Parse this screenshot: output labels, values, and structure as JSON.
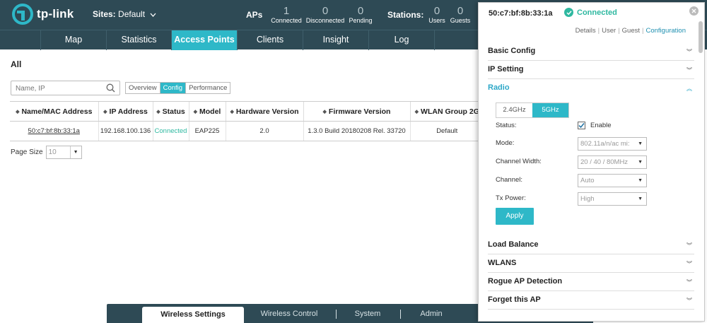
{
  "header": {
    "logo_text": "tp-link",
    "sites_label": "Sites:",
    "site_name": "Default",
    "aps_label": "APs",
    "aps": [
      {
        "value": "1",
        "label": "Connected"
      },
      {
        "value": "0",
        "label": "Disconnected"
      },
      {
        "value": "0",
        "label": "Pending"
      }
    ],
    "stations_label": "Stations:",
    "stations": [
      {
        "value": "0",
        "label": "Users"
      },
      {
        "value": "0",
        "label": "Guests"
      }
    ]
  },
  "nav": {
    "items": [
      "Map",
      "Statistics",
      "Access Points",
      "Clients",
      "Insight",
      "Log"
    ],
    "active": "Access Points"
  },
  "main": {
    "title": "All",
    "search_placeholder": "Name, IP",
    "view_tabs": [
      "Overview",
      "Config",
      "Performance"
    ],
    "active_view": "Config",
    "columns": [
      "Name/MAC Address",
      "IP Address",
      "Status",
      "Model",
      "Hardware Version",
      "Firmware Version",
      "WLAN Group 2G"
    ],
    "rows": [
      [
        "50:c7:bf:8b:33:1a",
        "192.168.100.136",
        "Connected",
        "EAP225",
        "2.0",
        "1.3.0 Build 20180208 Rel. 33720",
        "Default"
      ]
    ],
    "page_size_label": "Page Size",
    "page_size_value": "10"
  },
  "bottombar": {
    "items": [
      "Wireless Settings",
      "Wireless Control",
      "System",
      "Admin"
    ],
    "active": "Wireless Settings"
  },
  "panel": {
    "mac": "50:c7:bf:8b:33:1a",
    "status": "Connected",
    "links": [
      "Details",
      "User",
      "Guest",
      "Configuration"
    ],
    "active_link": "Configuration",
    "sections": [
      "Basic Config",
      "IP Setting",
      "Radio",
      "Load Balance",
      "WLANS",
      "Rogue AP Detection",
      "Forget this AP"
    ],
    "open_section": "Radio",
    "radio": {
      "bands": [
        "2.4GHz",
        "5GHz"
      ],
      "active_band": "5GHz",
      "status_label": "Status:",
      "enable_label": "Enable",
      "enabled": true,
      "mode_label": "Mode:",
      "mode_value": "802.11a/n/ac mi:",
      "channel_width_label": "Channel Width:",
      "channel_width_value": "20 / 40 / 80MHz",
      "channel_label": "Channel:",
      "channel_value": "Auto",
      "tx_power_label": "Tx Power:",
      "tx_power_value": "High",
      "apply_label": "Apply"
    }
  },
  "colors": {
    "header_bg": "#2e4a55",
    "accent": "#2eb8c8",
    "connected": "#2eb8a0"
  }
}
